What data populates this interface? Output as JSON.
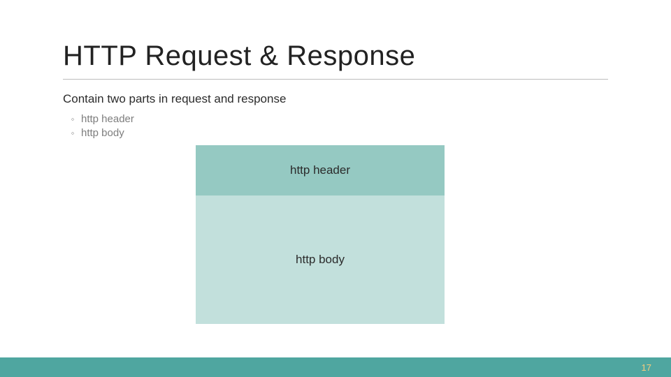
{
  "title": "HTTP Request & Response",
  "subtitle": "Contain two parts in request and response",
  "bullets": [
    "http header",
    "http body"
  ],
  "diagram": {
    "header_label": "http header",
    "body_label": "http body"
  },
  "page_number": "17"
}
